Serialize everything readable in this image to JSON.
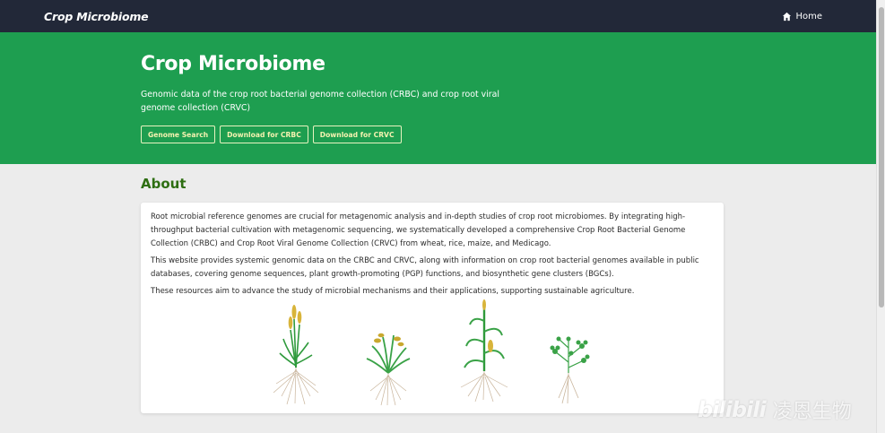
{
  "navbar": {
    "brand": "Crop Microbiome",
    "home_label": "Home"
  },
  "hero": {
    "title": "Crop Microbiome",
    "description": "Genomic data of the crop root bacterial genome collection (CRBC) and crop root viral genome collection (CRVC)",
    "buttons": [
      "Genome Search",
      "Download for CRBC",
      "Download for CRVC"
    ]
  },
  "about": {
    "title": "About",
    "paragraphs": [
      "Root microbial reference genomes are crucial for metagenomic analysis and in-depth studies of crop root microbiomes. By integrating high-throughput bacterial cultivation with metagenomic sequencing, we systematically developed a comprehensive Crop Root Bacterial Genome Collection (CRBC) and Crop Root Viral Genome Collection (CRVC) from wheat, rice, maize, and Medicago.",
      "This website provides systemic genomic data on the CRBC and CRVC, along with information on crop root bacterial genomes available in public databases, covering genome sequences, plant growth-promoting (PGP) functions, and biosynthetic gene clusters (BGCs).",
      "These resources aim to advance the study of microbial mechanisms and their applications, supporting sustainable agriculture."
    ],
    "illustrations": [
      "wheat-plant",
      "rice-plant",
      "maize-plant",
      "medicago-plant"
    ]
  },
  "watermark": {
    "logo": "bilibili",
    "text": "凌恩生物"
  },
  "colors": {
    "navbar_bg": "#222838",
    "hero_bg": "#1e9e50",
    "about_title": "#2e6e12",
    "button_text": "#f4f2b0"
  }
}
